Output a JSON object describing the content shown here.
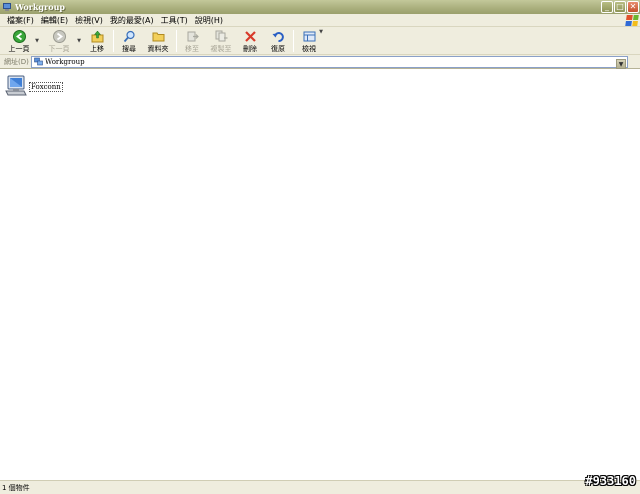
{
  "window": {
    "title": "Workgroup",
    "controls": {
      "minimize": "_",
      "maximize": "□",
      "close": "✕"
    }
  },
  "menu": {
    "items": [
      "檔案(F)",
      "編輯(E)",
      "檢視(V)",
      "我的最愛(A)",
      "工具(T)",
      "說明(H)"
    ]
  },
  "toolbar": {
    "back": "上一頁",
    "forward": "下一頁",
    "up": "上移",
    "search": "搜尋",
    "folders": "資料夾",
    "move_to": "移至",
    "copy_to": "複製至",
    "delete": "刪除",
    "undo": "復原",
    "views": "檢視"
  },
  "address": {
    "label": "網址(D)",
    "value": "Workgroup"
  },
  "content": {
    "items": [
      {
        "label": "Foxconn",
        "icon": "computer-icon"
      }
    ]
  },
  "status": {
    "text": "1 個物件"
  },
  "watermark": "#933160",
  "colors": {
    "title_bar": "#a9ae7c",
    "chrome": "#efedde",
    "back_green": "#3aa63a",
    "delete_red": "#d83a2a",
    "undo_blue": "#2a5fc4"
  }
}
